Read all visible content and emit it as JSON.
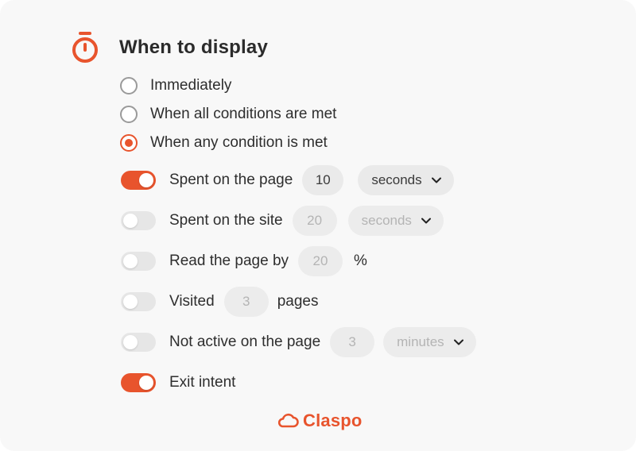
{
  "header": {
    "title": "When to display"
  },
  "radios": [
    {
      "label": "Immediately",
      "checked": false
    },
    {
      "label": "When all conditions are met",
      "checked": false
    },
    {
      "label": "When any condition is met",
      "checked": true
    }
  ],
  "conditions": {
    "spent_on_page": {
      "label": "Spent on the page",
      "enabled": true,
      "value": "10",
      "unit": "seconds"
    },
    "spent_on_site": {
      "label": "Spent on the site",
      "enabled": false,
      "value": "20",
      "unit": "seconds"
    },
    "read_page": {
      "label": "Read the page by",
      "enabled": false,
      "value": "20",
      "suffix": "%"
    },
    "visited": {
      "label": "Visited",
      "enabled": false,
      "value": "3",
      "suffix": "pages"
    },
    "not_active": {
      "label": "Not active on the page",
      "enabled": false,
      "value": "3",
      "unit": "minutes"
    },
    "exit_intent": {
      "label": "Exit intent",
      "enabled": true
    }
  },
  "brand": {
    "name": "Claspo"
  },
  "colors": {
    "accent": "#e8542d",
    "toggle_off": "#e6e6e6",
    "field_bg": "#eaeaea"
  },
  "icons": {
    "header": "stopwatch-icon",
    "select": "chevron-down-icon",
    "brand": "cloud-logo-icon"
  }
}
